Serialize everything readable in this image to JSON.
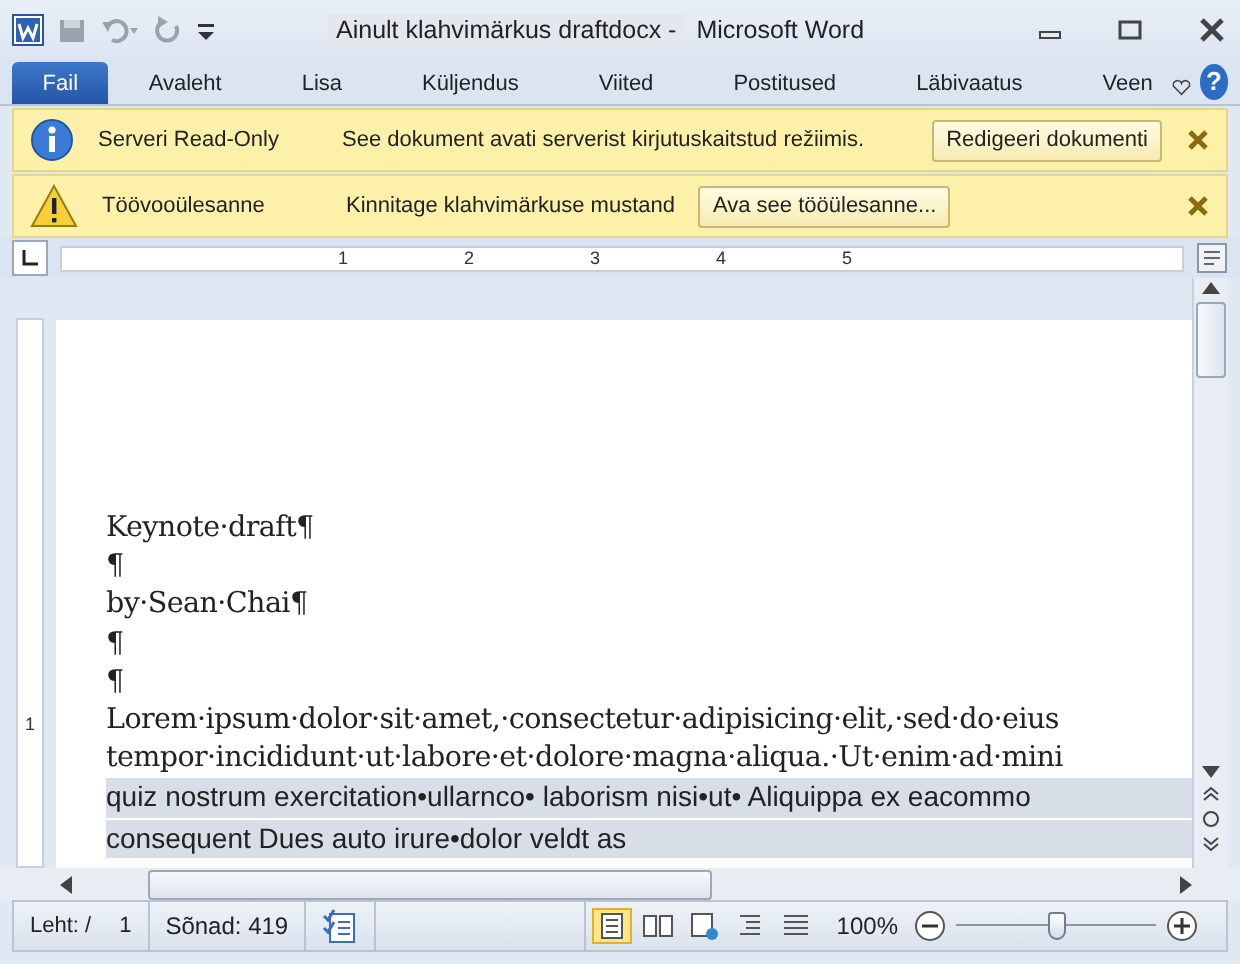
{
  "window": {
    "title": "Ainult klahvimärkus draftdocx -",
    "app_name": "Microsoft Word"
  },
  "tabs": [
    {
      "label": "Fail",
      "selected": true
    },
    {
      "label": "Avaleht",
      "selected": false
    },
    {
      "label": "Lisa",
      "selected": false
    },
    {
      "label": "Küljendus",
      "selected": false
    },
    {
      "label": "Viited",
      "selected": false
    },
    {
      "label": "Postitused",
      "selected": false
    },
    {
      "label": "Läbivaatus",
      "selected": false
    },
    {
      "label": "Veen",
      "selected": false
    }
  ],
  "help_button": "?",
  "message_bars": [
    {
      "kind": "info",
      "title": "Serveri Read-Only",
      "message": "See dokument avati serverist kirjutuskaitstud režiimis.",
      "button": "Redigeeri dokumenti"
    },
    {
      "kind": "warning",
      "title": "Töövooülesanne",
      "message": "Kinnitage klahvimärkuse mustand",
      "button": "Ava see tööülesanne..."
    }
  ],
  "ruler": {
    "marks": [
      "1",
      "2",
      "3",
      "4",
      "5"
    ]
  },
  "vertical_ruler": {
    "marks": [
      "1"
    ]
  },
  "document": {
    "paragraphs": [
      {
        "kind": "plain",
        "text": "Keynote·draft¶"
      },
      {
        "kind": "plain",
        "text": "¶"
      },
      {
        "kind": "plain",
        "text": "by·Sean·Chai¶"
      },
      {
        "kind": "plain",
        "text": "¶"
      },
      {
        "kind": "plain",
        "text": "¶"
      },
      {
        "kind": "plain",
        "text": "Lorem·ipsum·dolor·sit·amet,·consectetur·adipisicing·elit,·sed·do·eius"
      },
      {
        "kind": "plain",
        "text": "tempor·incididunt·ut·labore·et·dolore·magna·aliqua.·Ut·enim·ad·mini"
      },
      {
        "kind": "highlighted",
        "text": "quiz nostrum exercitation•ullarnco• laborism nisi•ut• Aliquippa ex eacommo"
      },
      {
        "kind": "highlighted",
        "text": "consequent Dues auto irure•dolor veldt as"
      }
    ]
  },
  "status_bar": {
    "page_label": "Leht: /",
    "page_number": "1",
    "word_count": "Sõnad: 419",
    "view_buttons": [
      {
        "kind": "print",
        "selected": true
      },
      {
        "kind": "reading",
        "selected": false
      },
      {
        "kind": "web",
        "selected": false
      },
      {
        "kind": "outline",
        "selected": false
      },
      {
        "kind": "draft",
        "selected": false
      }
    ],
    "zoom": "100%",
    "zoom_level": {
      "level": 0.5
    }
  }
}
